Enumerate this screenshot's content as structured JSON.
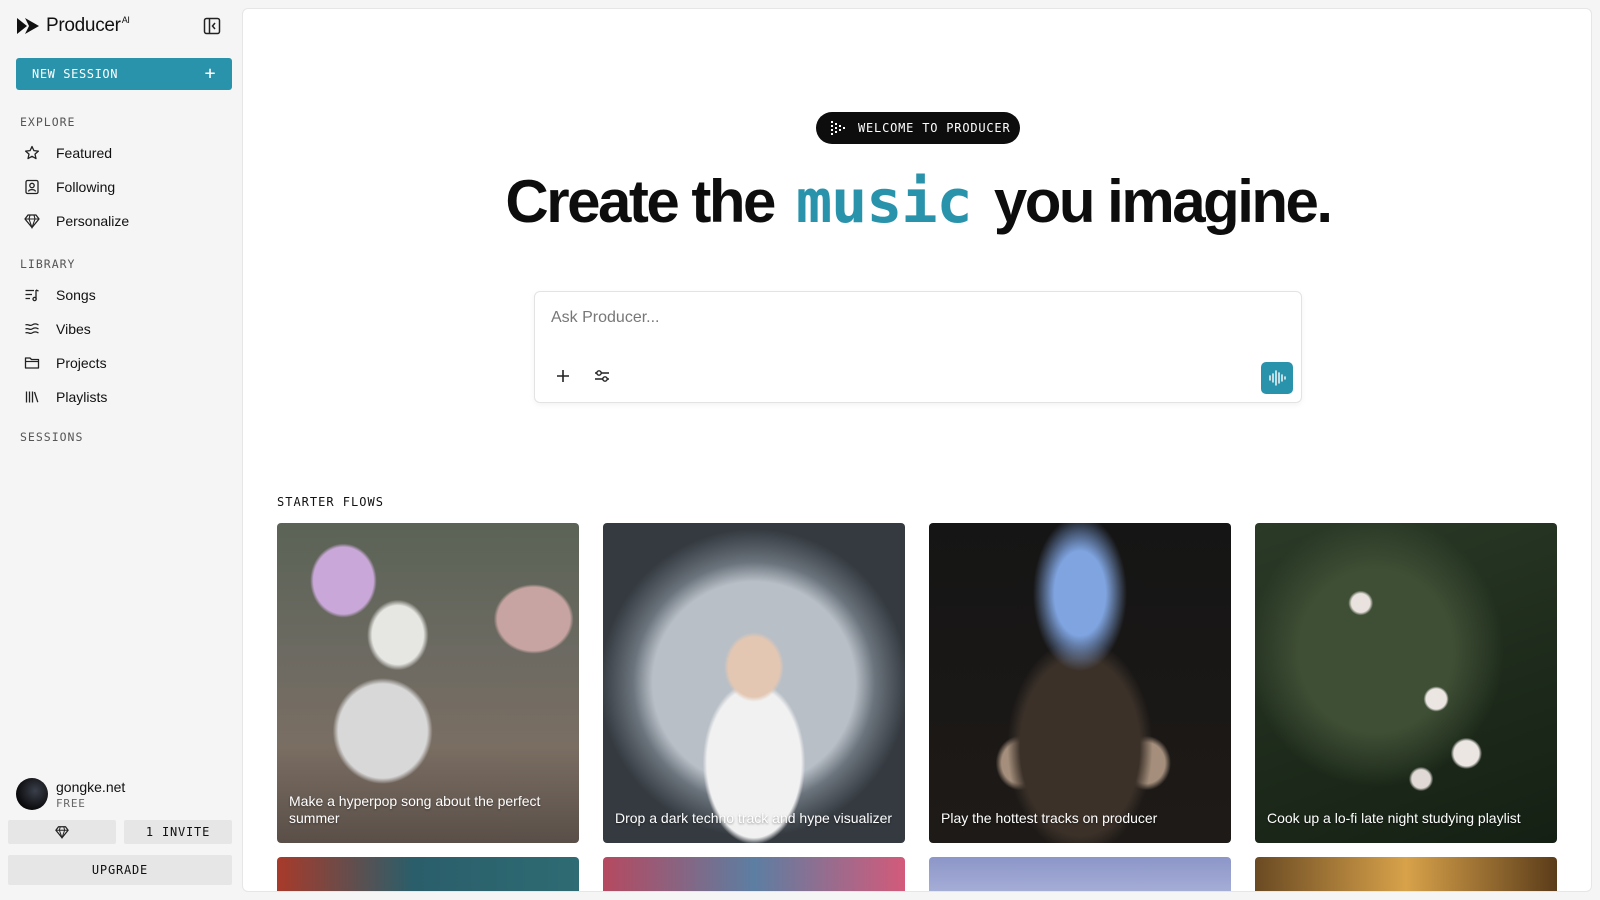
{
  "brand": {
    "name": "Producer",
    "sup": "AI"
  },
  "sidebar": {
    "new_session_label": "NEW SESSION",
    "explore_label": "EXPLORE",
    "explore_items": [
      {
        "label": "Featured",
        "icon": "star-icon"
      },
      {
        "label": "Following",
        "icon": "following-icon"
      },
      {
        "label": "Personalize",
        "icon": "gem-icon"
      }
    ],
    "library_label": "LIBRARY",
    "library_items": [
      {
        "label": "Songs",
        "icon": "songs-icon"
      },
      {
        "label": "Vibes",
        "icon": "waves-icon"
      },
      {
        "label": "Projects",
        "icon": "folder-icon"
      },
      {
        "label": "Playlists",
        "icon": "library-icon"
      }
    ],
    "sessions_label": "SESSIONS",
    "user": {
      "name": "gongke.net",
      "plan": "FREE"
    },
    "invite_label": "1 INVITE",
    "upgrade_label": "UPGRADE"
  },
  "main": {
    "welcome_badge": "WELCOME TO PRODUCER",
    "headline_pre": "Create the",
    "headline_accent": "music",
    "headline_post": "you imagine.",
    "prompt_placeholder": "Ask Producer...",
    "starter_flows_label": "STARTER FLOWS",
    "starter_flows": [
      {
        "caption": "Make a hyperpop song about the perfect summer"
      },
      {
        "caption": "Drop a dark techno track and hype visualizer"
      },
      {
        "caption": "Play the hottest tracks on producer"
      },
      {
        "caption": "Cook up a lo-fi late night studying playlist"
      }
    ]
  },
  "colors": {
    "accent": "#2a93ac",
    "badge_bg": "#0d0d0d",
    "sidebar_bg": "#f5f5f5"
  }
}
